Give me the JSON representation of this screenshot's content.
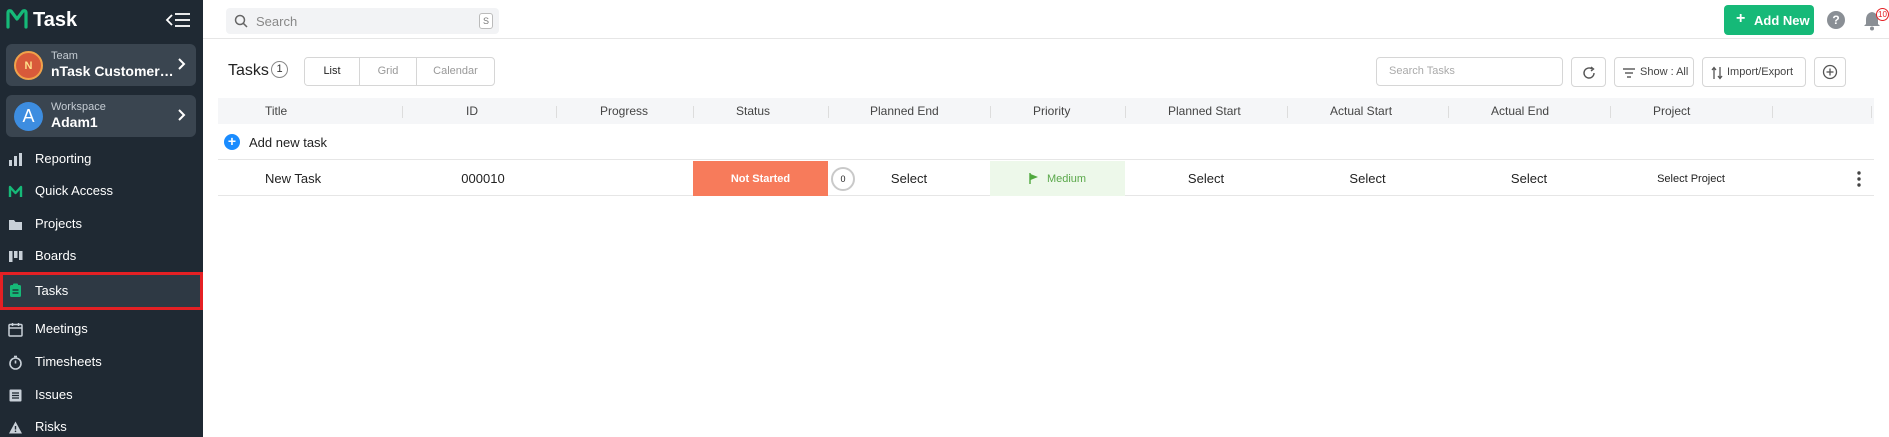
{
  "app": {
    "name": "Task"
  },
  "sidebar": {
    "team": {
      "kicker": "Team",
      "name": "nTask Customer S...",
      "avatar_text": "N"
    },
    "workspace": {
      "kicker": "Workspace",
      "name": "Adam1",
      "avatar_text": "A"
    },
    "items": [
      {
        "label": "Reporting",
        "icon": "bar-chart-icon"
      },
      {
        "label": "Quick Access",
        "icon": "ntask-logo-icon"
      },
      {
        "label": "Projects",
        "icon": "folder-icon"
      },
      {
        "label": "Boards",
        "icon": "board-icon"
      },
      {
        "label": "Tasks",
        "icon": "clipboard-icon",
        "active": true
      },
      {
        "label": "Meetings",
        "icon": "calendar-icon"
      },
      {
        "label": "Timesheets",
        "icon": "stopwatch-icon"
      },
      {
        "label": "Issues",
        "icon": "issue-list-icon"
      },
      {
        "label": "Risks",
        "icon": "warning-icon"
      }
    ]
  },
  "topbar": {
    "search_placeholder": "Search",
    "search_shortcut": "S",
    "add_new_label": "Add New",
    "help_glyph": "?",
    "notification_count": "10"
  },
  "toolbar": {
    "title": "Tasks",
    "count": "1",
    "views": [
      "List",
      "Grid",
      "Calendar"
    ],
    "search_tasks_placeholder": "Search Tasks",
    "show_label": "Show : All",
    "import_export_label": "Import/Export"
  },
  "table": {
    "columns": [
      "Title",
      "ID",
      "Progress",
      "Status",
      "Planned End",
      "Priority",
      "Planned Start",
      "Actual Start",
      "Actual End",
      "Project"
    ],
    "add_new_label": "Add new task",
    "rows": [
      {
        "title": "New Task",
        "id": "000010",
        "progress": "0",
        "status": "Not Started",
        "planned_end": "Select",
        "priority": "Medium",
        "planned_start": "Select",
        "actual_start": "Select",
        "actual_end": "Select",
        "project": "Select Project"
      }
    ]
  },
  "colors": {
    "sidebar_bg": "#1f2933",
    "accent_green": "#16b978",
    "status_not_started": "#f77b5b",
    "priority_medium_bg": "#edf8ea",
    "highlight_red": "#e42024"
  }
}
